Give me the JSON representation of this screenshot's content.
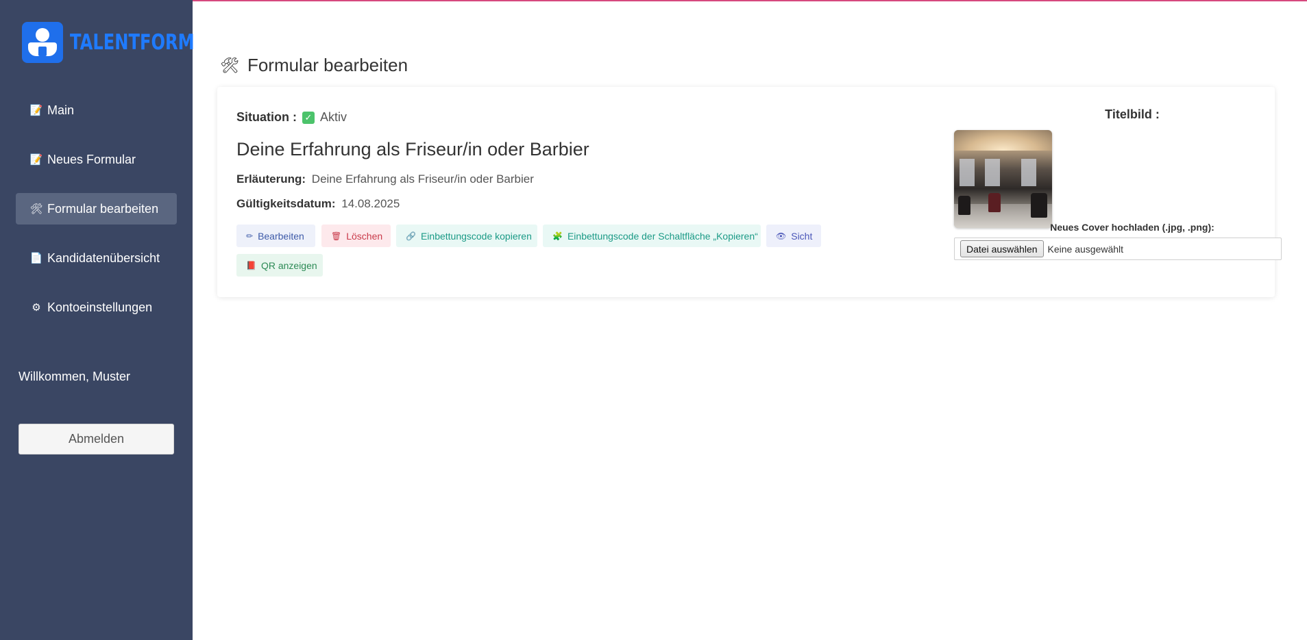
{
  "brand": {
    "name": "TALENTFORM",
    "color": "#1f7bff"
  },
  "sidebar": {
    "items": [
      {
        "label": "Main",
        "icon": "document-icon"
      },
      {
        "label": "Neues Formular",
        "icon": "document-icon"
      },
      {
        "label": "Formular bearbeiten",
        "icon": "tools-icon",
        "active": true
      },
      {
        "label": "Kandidatenübersicht",
        "icon": "page-icon"
      },
      {
        "label": "Kontoeinstellungen",
        "icon": "gear-icon"
      }
    ],
    "welcome": "Willkommen, Muster",
    "logout_label": "Abmelden",
    "background": "#3a4663"
  },
  "page": {
    "title": "Formular bearbeiten",
    "icon": "tools-icon"
  },
  "form": {
    "status_label": "Situation :",
    "status_value": "Aktiv",
    "title": "Deine Erfahrung als Friseur/in oder Barbier",
    "description_label": "Erläuterung:",
    "description_value": "Deine Erfahrung als Friseur/in oder Barbier",
    "valid_label": "Gültigkeitsdatum:",
    "valid_value": "14.08.2025",
    "actions": {
      "edit": "Bearbeiten",
      "delete": "Löschen",
      "copy_embed": "Einbettungscode kopieren",
      "copy_button_embed": "Einbettungscode der Schaltfläche „Kopieren“",
      "view": "Sicht",
      "show_qr": "QR anzeigen"
    }
  },
  "cover": {
    "label": "Titelbild :",
    "upload_label": "Neues Cover hochladen (.jpg, .png):",
    "file_button": "Datei auswählen",
    "file_status": "Keine ausgewählt"
  },
  "colors": {
    "accent_line": "#d6487e",
    "active_check": "#4cc36b"
  }
}
